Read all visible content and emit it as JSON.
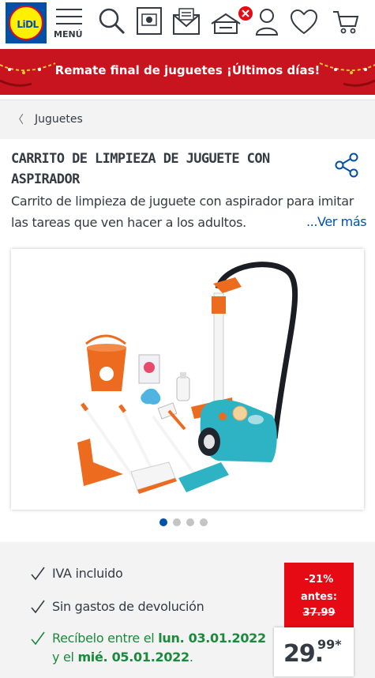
{
  "header": {
    "logo_text": "LiDL",
    "menu_label": "MENÚ",
    "icons": [
      "search-icon",
      "leaflet-icon",
      "card-icon",
      "mail-icon",
      "home-delivery-icon",
      "user-icon",
      "heart-icon",
      "cart-icon"
    ],
    "notification_badge": "×"
  },
  "promo": {
    "text": "Remate final de juguetes ¡Últimos días!"
  },
  "breadcrumb": {
    "label": "Juguetes"
  },
  "product": {
    "title_line1": "CARRITO DE LIMPIEZA DE JUGUETE CON",
    "title_line2": "ASPIRADOR",
    "description_line1": "Carrito de limpieza de juguete con aspirador para imitar",
    "description_line2": "las tareas que ven hacer a los adultos.",
    "more_link": "...Ver más"
  },
  "gallery": {
    "active_index": 0,
    "count": 4
  },
  "features": {
    "vat": "IVA incluido",
    "returns": "Sin gastos de devolución",
    "delivery_prefix": "Recíbelo entre el ",
    "delivery_from": "lun. 03.01.2022",
    "delivery_and": "y el ",
    "delivery_to": "mié. 05.01.2022",
    "delivery_suffix": "."
  },
  "price": {
    "discount": "-21%",
    "antes_label": "antes:",
    "old_price": "37.99",
    "current_main": "29.",
    "current_cents": "99*"
  },
  "colors": {
    "brand_blue": "#0050aa",
    "brand_red": "#e60a14",
    "brand_yellow": "#fff000",
    "delivery_green": "#1a8a3c"
  }
}
